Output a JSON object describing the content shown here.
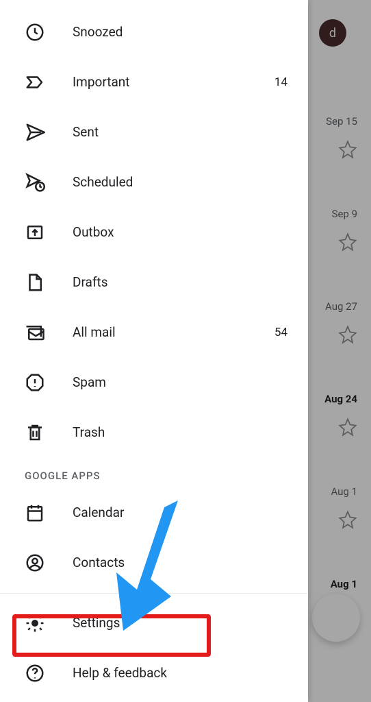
{
  "drawer": {
    "items": [
      {
        "label": "Snoozed",
        "count": ""
      },
      {
        "label": "Important",
        "count": "14"
      },
      {
        "label": "Sent",
        "count": ""
      },
      {
        "label": "Scheduled",
        "count": ""
      },
      {
        "label": "Outbox",
        "count": ""
      },
      {
        "label": "Drafts",
        "count": ""
      },
      {
        "label": "All mail",
        "count": "54"
      },
      {
        "label": "Spam",
        "count": ""
      },
      {
        "label": "Trash",
        "count": ""
      }
    ],
    "section_google_apps": "GOOGLE APPS",
    "apps": [
      {
        "label": "Calendar"
      },
      {
        "label": "Contacts"
      }
    ],
    "bottom": [
      {
        "label": "Settings"
      },
      {
        "label": "Help & feedback"
      }
    ]
  },
  "background": {
    "avatar_letter": "d",
    "dates": [
      "Sep 15",
      "Sep 9",
      "Aug 27",
      "Aug 24",
      "Aug 1",
      "Aug 1"
    ]
  }
}
